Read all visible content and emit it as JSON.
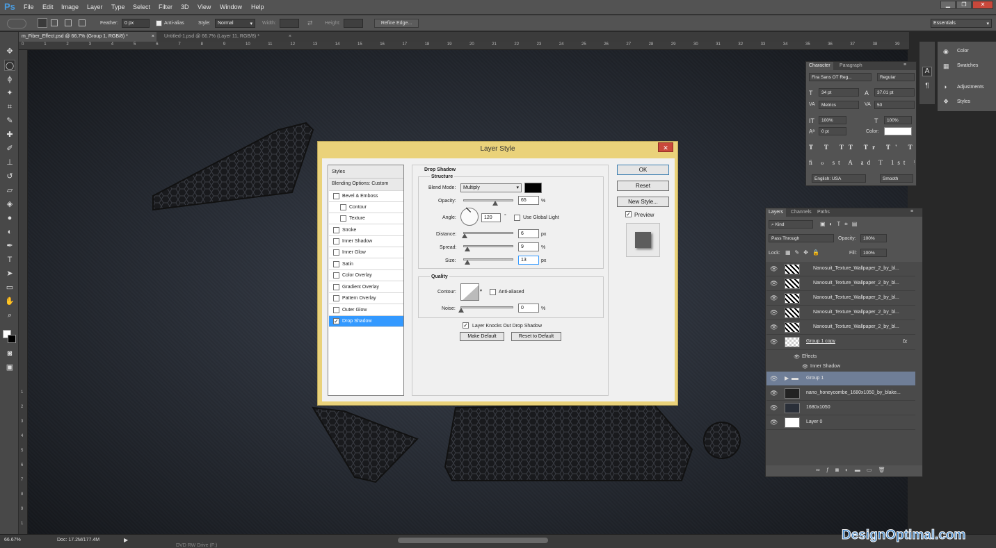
{
  "app": {
    "logo": "Ps"
  },
  "menu": [
    "File",
    "Edit",
    "Image",
    "Layer",
    "Type",
    "Select",
    "Filter",
    "3D",
    "View",
    "Window",
    "Help"
  ],
  "options": {
    "feather_label": "Feather:",
    "feather_value": "0 px",
    "antialias_label": "Anti-alias",
    "style_label": "Style:",
    "style_value": "Normal",
    "width_label": "Width:",
    "height_label": "Height:",
    "refine_edge": "Refine Edge...",
    "workspace": "Essentials"
  },
  "tabs": [
    {
      "label": "m_Fiber_Effect.psd @ 66.7% (Group 1, RGB/8) *"
    },
    {
      "label": "Untitled-1.psd @ 66.7% (Layer 11, RGB/8) *"
    }
  ],
  "ruler": [
    "0",
    "1",
    "2",
    "3",
    "4",
    "5",
    "6",
    "7",
    "8",
    "9",
    "10",
    "11",
    "12",
    "13",
    "14",
    "15",
    "16",
    "17",
    "18",
    "19",
    "20",
    "21",
    "22",
    "23",
    "24",
    "25",
    "26",
    "27",
    "28",
    "29",
    "30",
    "31",
    "32",
    "33",
    "34",
    "35",
    "36",
    "37",
    "38",
    "39"
  ],
  "vruler": [
    "1",
    "2",
    "3",
    "4",
    "5",
    "6",
    "7",
    "8",
    "9",
    "1"
  ],
  "status": {
    "zoom": "66.67%",
    "doc": "Doc: 17.2M/177.4M",
    "taskbar": "DVD RW Drive (F:)"
  },
  "watermark": "DesignOptimal.com",
  "mini_panel": {
    "color": "Color",
    "swatches": "Swatches",
    "adjustments": "Adjustments",
    "styles": "Styles"
  },
  "character": {
    "tab_character": "Character",
    "tab_paragraph": "Paragraph",
    "font": "Fira Sans OT Reg...",
    "weight": "Regular",
    "size": "34 pt",
    "leading": "37.01 pt",
    "kerning": "Metrics",
    "tracking": "50",
    "vscale": "100%",
    "hscale": "100%",
    "baseline": "0 pt",
    "color_label": "Color:",
    "language": "English: USA",
    "antialias": "Smooth"
  },
  "layers": {
    "tab_layers": "Layers",
    "tab_channels": "Channels",
    "tab_paths": "Paths",
    "filter_kind": "Kind",
    "blend_mode": "Pass Through",
    "opacity_label": "Opacity:",
    "opacity": "100%",
    "lock_label": "Lock:",
    "fill_label": "Fill:",
    "fill": "100%",
    "effects_label": "Effects",
    "inner_shadow_label": "Inner Shadow",
    "fx": "fx",
    "rows": [
      {
        "name": "Nanosuit_Texture_Wallpaper_2_by_bl..."
      },
      {
        "name": "Nanosuit_Texture_Wallpaper_2_by_bl..."
      },
      {
        "name": "Nanosuit_Texture_Wallpaper_2_by_bl..."
      },
      {
        "name": "Nanosuit_Texture_Wallpaper_2_by_bl..."
      },
      {
        "name": "Nanosuit_Texture_Wallpaper_2_by_bl..."
      },
      {
        "name": "Group 1 copy"
      },
      {
        "name": "Group 1"
      },
      {
        "name": "nano_honeycombe_1680x1050_by_blake..."
      },
      {
        "name": "1680x1050"
      },
      {
        "name": "Layer 0"
      }
    ]
  },
  "dialog": {
    "title": "Layer Style",
    "close": "✕",
    "styles_header": "Styles",
    "style_items": [
      {
        "label": "Blending Options: Custom"
      },
      {
        "label": "Bevel & Emboss"
      },
      {
        "label": "Contour"
      },
      {
        "label": "Texture"
      },
      {
        "label": "Stroke"
      },
      {
        "label": "Inner Shadow"
      },
      {
        "label": "Inner Glow"
      },
      {
        "label": "Satin"
      },
      {
        "label": "Color Overlay"
      },
      {
        "label": "Gradient Overlay"
      },
      {
        "label": "Pattern Overlay"
      },
      {
        "label": "Outer Glow"
      },
      {
        "label": "Drop Shadow"
      }
    ],
    "section_title": "Drop Shadow",
    "structure_title": "Structure",
    "blend_mode_label": "Blend Mode:",
    "blend_mode": "Multiply",
    "opacity_label": "Opacity:",
    "opacity": "65",
    "angle_label": "Angle:",
    "angle": "120",
    "use_global_light": "Use Global Light",
    "distance_label": "Distance:",
    "distance": "6",
    "spread_label": "Spread:",
    "spread": "9",
    "size_label": "Size:",
    "size": "13",
    "px": "px",
    "pct": "%",
    "deg": "°",
    "quality_title": "Quality",
    "contour_label": "Contour:",
    "antialiased": "Anti-aliased",
    "noise_label": "Noise:",
    "noise": "0",
    "knockout": "Layer Knocks Out Drop Shadow",
    "make_default": "Make Default",
    "reset_default": "Reset to Default",
    "ok": "OK",
    "reset": "Reset",
    "new_style": "New Style...",
    "preview": "Preview"
  }
}
